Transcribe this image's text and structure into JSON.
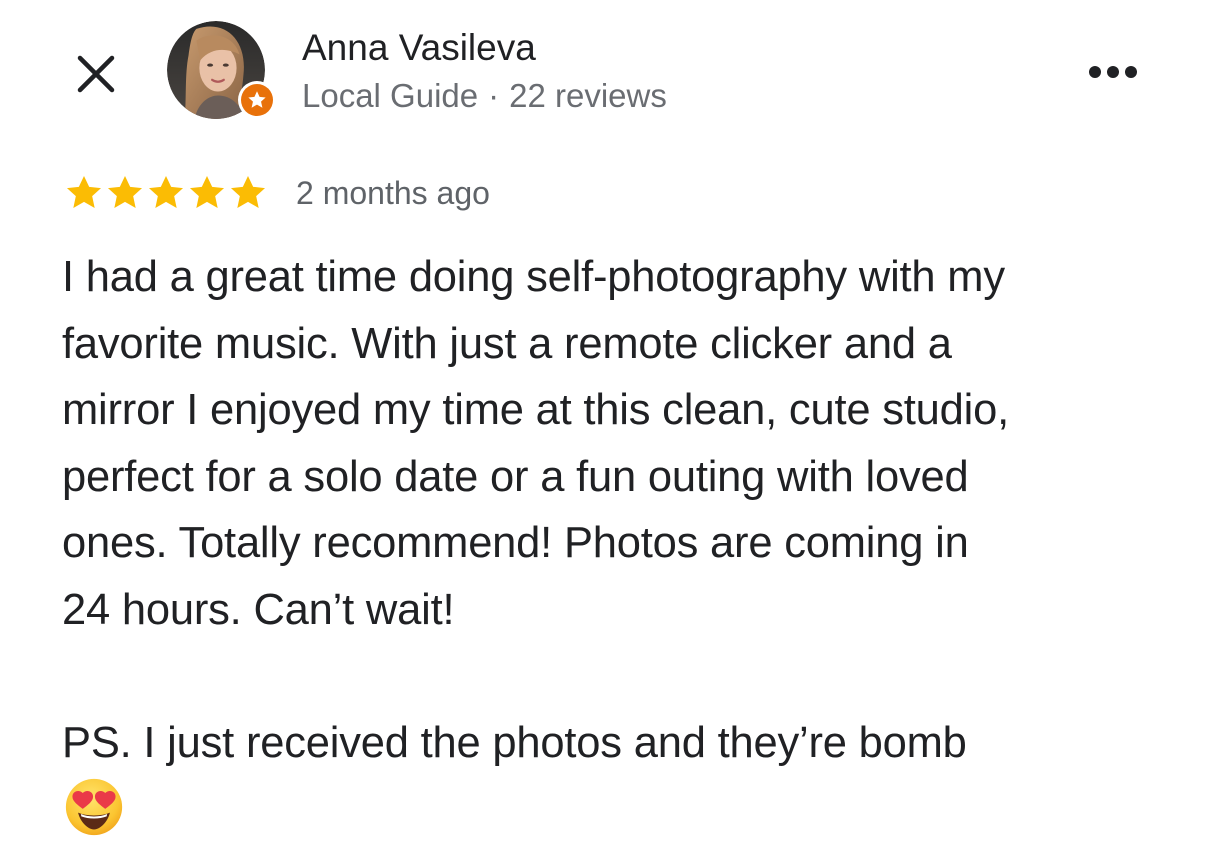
{
  "header": {
    "close_icon": "close-icon",
    "more_icon": "more-horizontal-icon",
    "author": {
      "name": "Anna Vasileva",
      "badge": "Local Guide",
      "separator": "·",
      "review_count": "22 reviews",
      "badge_icon": "local-guide-star-icon",
      "badge_color": "#e8710a"
    }
  },
  "review": {
    "rating": 5,
    "rating_max": 5,
    "star_color": "#fbbc04",
    "date": "2 months ago",
    "text": "I had a great time doing self-photography with my\nfavorite music. With just a remote clicker and a\nmirror I enjoyed my time at this clean, cute studio,\nperfect for a solo date or a fun outing with loved\nones. Totally recommend! Photos are coming in\n24 hours. Can’t wait!\n\nPS. I just received the photos and they’re bomb",
    "emoji_icon": "heart-eyes-emoji-icon"
  }
}
